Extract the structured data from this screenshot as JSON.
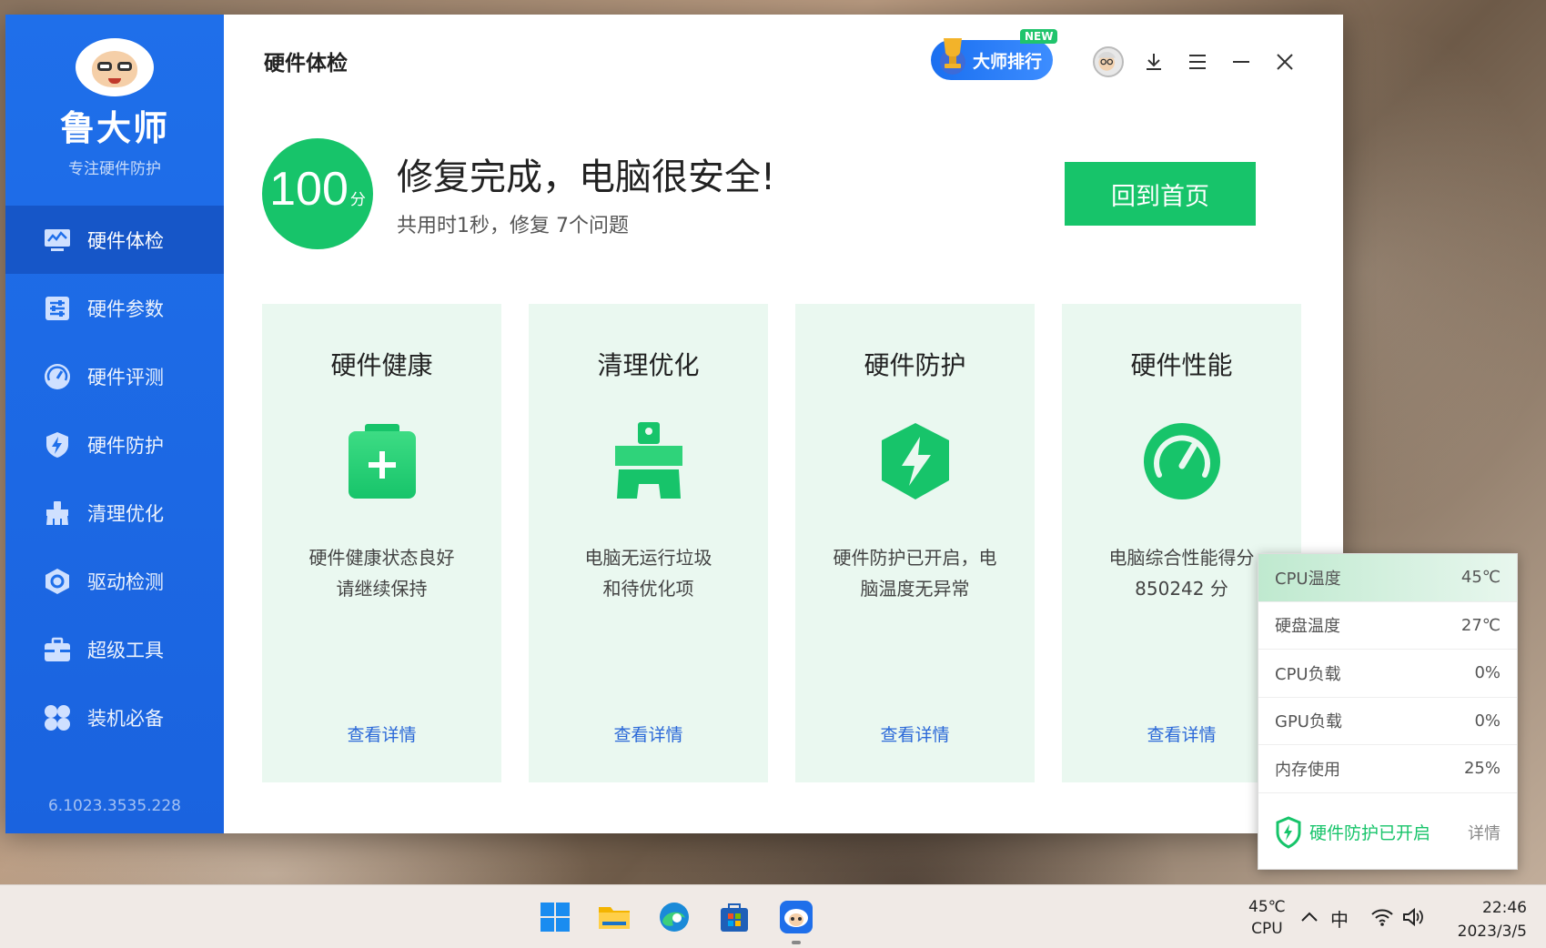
{
  "sidebar": {
    "brand_name": "鲁大师",
    "brand_slogan": "专注硬件防护",
    "items": [
      {
        "label": "硬件体检",
        "icon": "monitor-check-icon",
        "active": true
      },
      {
        "label": "硬件参数",
        "icon": "sliders-icon",
        "active": false
      },
      {
        "label": "硬件评测",
        "icon": "speedometer-icon",
        "active": false
      },
      {
        "label": "硬件防护",
        "icon": "shield-bolt-icon",
        "active": false
      },
      {
        "label": "清理优化",
        "icon": "broom-icon",
        "active": false
      },
      {
        "label": "驱动检测",
        "icon": "hexagon-driver-icon",
        "active": false
      },
      {
        "label": "超级工具",
        "icon": "toolbox-icon",
        "active": false
      },
      {
        "label": "装机必备",
        "icon": "clover-apps-icon",
        "active": false
      }
    ],
    "version": "6.1023.3535.228"
  },
  "header": {
    "title": "硬件体检",
    "rank_label": "大师排行",
    "new_tag": "NEW"
  },
  "result": {
    "score": "100",
    "score_unit": "分",
    "title": "修复完成，电脑很安全!",
    "subtitle": "共用时1秒，修复 7个问题",
    "home_button": "回到首页"
  },
  "cards": [
    {
      "title": "硬件健康",
      "icon": "clipboard-plus-icon",
      "desc_line1": "硬件健康状态良好",
      "desc_line2": "请继续保持",
      "link": "查看详情"
    },
    {
      "title": "清理优化",
      "icon": "broom-icon",
      "desc_line1": "电脑无运行垃圾",
      "desc_line2": "和待优化项",
      "link": "查看详情"
    },
    {
      "title": "硬件防护",
      "icon": "shield-bolt-icon",
      "desc_line1": "硬件防护已开启，电",
      "desc_line2": "脑温度无异常",
      "link": "查看详情"
    },
    {
      "title": "硬件性能",
      "icon": "speedometer-icon",
      "desc_line1": "电脑综合性能得分",
      "desc_line2": "850242 分",
      "link": "查看详情"
    }
  ],
  "monitor": {
    "rows": [
      {
        "label": "CPU温度",
        "value": "45℃"
      },
      {
        "label": "硬盘温度",
        "value": "27℃"
      },
      {
        "label": "CPU负载",
        "value": "0%"
      },
      {
        "label": "GPU负载",
        "value": "0%"
      },
      {
        "label": "内存使用",
        "value": "25%"
      }
    ],
    "status": "硬件防护已开启",
    "detail": "详情"
  },
  "taskbar": {
    "cpu_temp": "45℃",
    "cpu_label": "CPU",
    "ime": "中",
    "time": "22:46",
    "date": "2023/3/5"
  },
  "colors": {
    "sidebar_blue": "#1f6fea",
    "accent_green": "#17c46a",
    "card_bg": "#eaf8f0",
    "link_blue": "#2a68d8"
  }
}
